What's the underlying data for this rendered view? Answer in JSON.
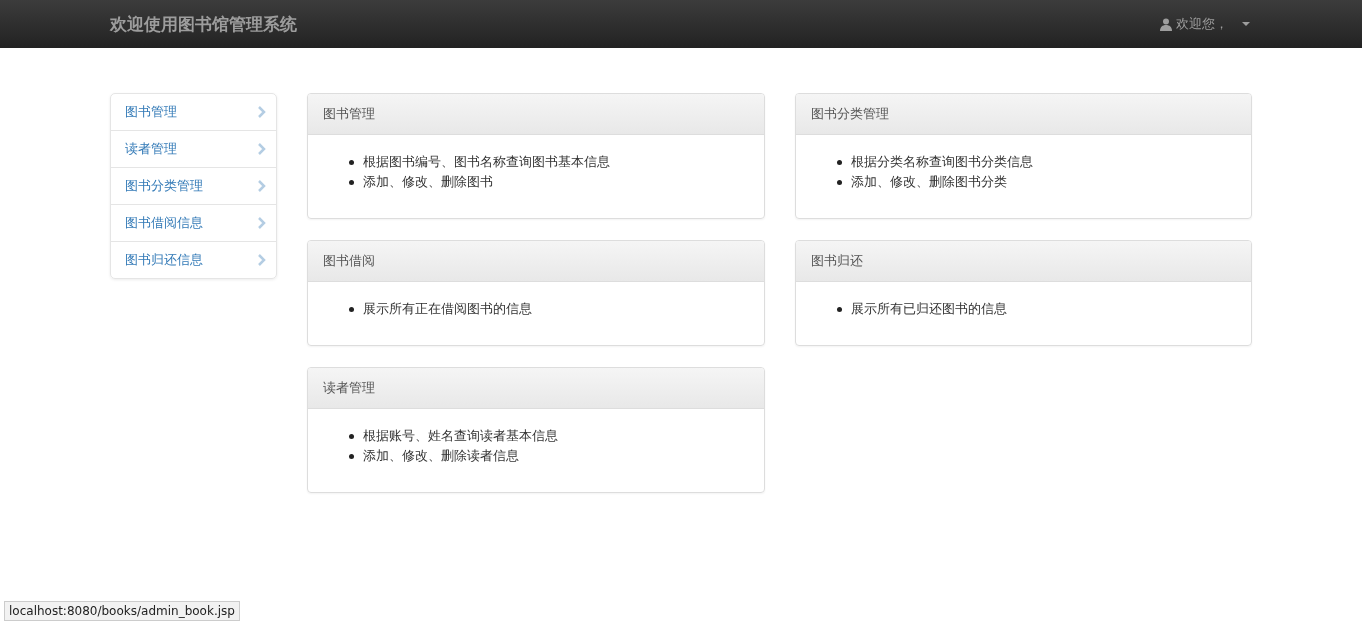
{
  "navbar": {
    "brand": "欢迎使用图书馆管理系统",
    "user_menu": "欢迎您，"
  },
  "sidebar": {
    "items": [
      {
        "label": "图书管理"
      },
      {
        "label": "读者管理"
      },
      {
        "label": "图书分类管理"
      },
      {
        "label": "图书借阅信息"
      },
      {
        "label": "图书归还信息"
      }
    ]
  },
  "panels": [
    {
      "title": "图书管理",
      "items": [
        "根据图书编号、图书名称查询图书基本信息",
        "添加、修改、删除图书"
      ]
    },
    {
      "title": "图书分类管理",
      "items": [
        "根据分类名称查询图书分类信息",
        "添加、修改、删除图书分类"
      ]
    },
    {
      "title": "图书借阅",
      "items": [
        "展示所有正在借阅图书的信息"
      ]
    },
    {
      "title": "图书归还",
      "items": [
        "展示所有已归还图书的信息"
      ]
    },
    {
      "title": "读者管理",
      "items": [
        "根据账号、姓名查询读者基本信息",
        "添加、修改、删除读者信息"
      ]
    }
  ],
  "status_bar": {
    "url": "localhost:8080/books/admin_book.jsp"
  }
}
